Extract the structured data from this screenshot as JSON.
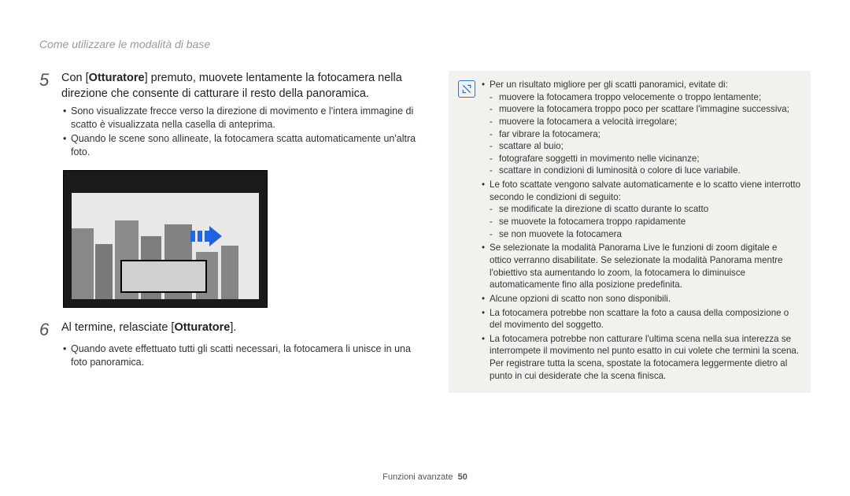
{
  "header": "Come utilizzare le modalità di base",
  "steps": {
    "s5": {
      "num": "5",
      "text_a": "Con [",
      "text_b": "Otturatore",
      "text_c": "] premuto, muovete lentamente la fotocamera nella direzione che consente di catturare il resto della panoramica.",
      "bullets": [
        "Sono visualizzate frecce verso la direzione di movimento e l'intera immagine di scatto è visualizzata nella casella di anteprima.",
        "Quando le scene sono allineate, la fotocamera scatta automaticamente un'altra foto."
      ]
    },
    "s6": {
      "num": "6",
      "text_a": "Al termine, relasciate [",
      "text_b": "Otturatore",
      "text_c": "].",
      "bullets": [
        "Quando avete effettuato tutti gli scatti necessari, la fotocamera li unisce in una foto panoramica."
      ]
    }
  },
  "notes": {
    "n1": {
      "lead": "Per un risultato migliore per gli scatti panoramici, evitate di:",
      "dash": [
        "muovere la fotocamera troppo velocemente o troppo lentamente;",
        "muovere la fotocamera troppo poco per scattare l'immagine successiva;",
        "muovere la fotocamera a velocità irregolare;",
        "far vibrare la fotocamera;",
        "scattare al buio;",
        "fotografare soggetti in movimento nelle vicinanze;",
        "scattare in condizioni di luminosità o colore di luce variabile."
      ]
    },
    "n2": {
      "lead": "Le foto scattate vengono salvate automaticamente e lo scatto viene interrotto secondo le condizioni di seguito:",
      "dash": [
        "se modificate la direzione di scatto durante lo scatto",
        "se muovete la fotocamera troppo rapidamente",
        "se non muovete la fotocamera"
      ]
    },
    "n3": "Se selezionate la modalità Panorama Live le funzioni di zoom digitale e ottico verranno disabilitate. Se selezionate la modalità Panorama mentre l'obiettivo sta aumentando lo zoom, la fotocamera lo diminuisce automaticamente  fino alla posizione predefinita.",
    "n4": "Alcune opzioni di scatto non sono disponibili.",
    "n5": "La fotocamera potrebbe non scattare la foto a causa della composizione o del movimento del soggetto.",
    "n6": "La fotocamera potrebbe non catturare l'ultima scena nella sua interezza se interrompete il movimento nel punto esatto in cui volete che termini la scena. Per registrare tutta la scena, spostate la fotocamera leggermente dietro al punto in cui desiderate che la scena finisca."
  },
  "footer": {
    "label": "Funzioni avanzate",
    "page": "50"
  }
}
